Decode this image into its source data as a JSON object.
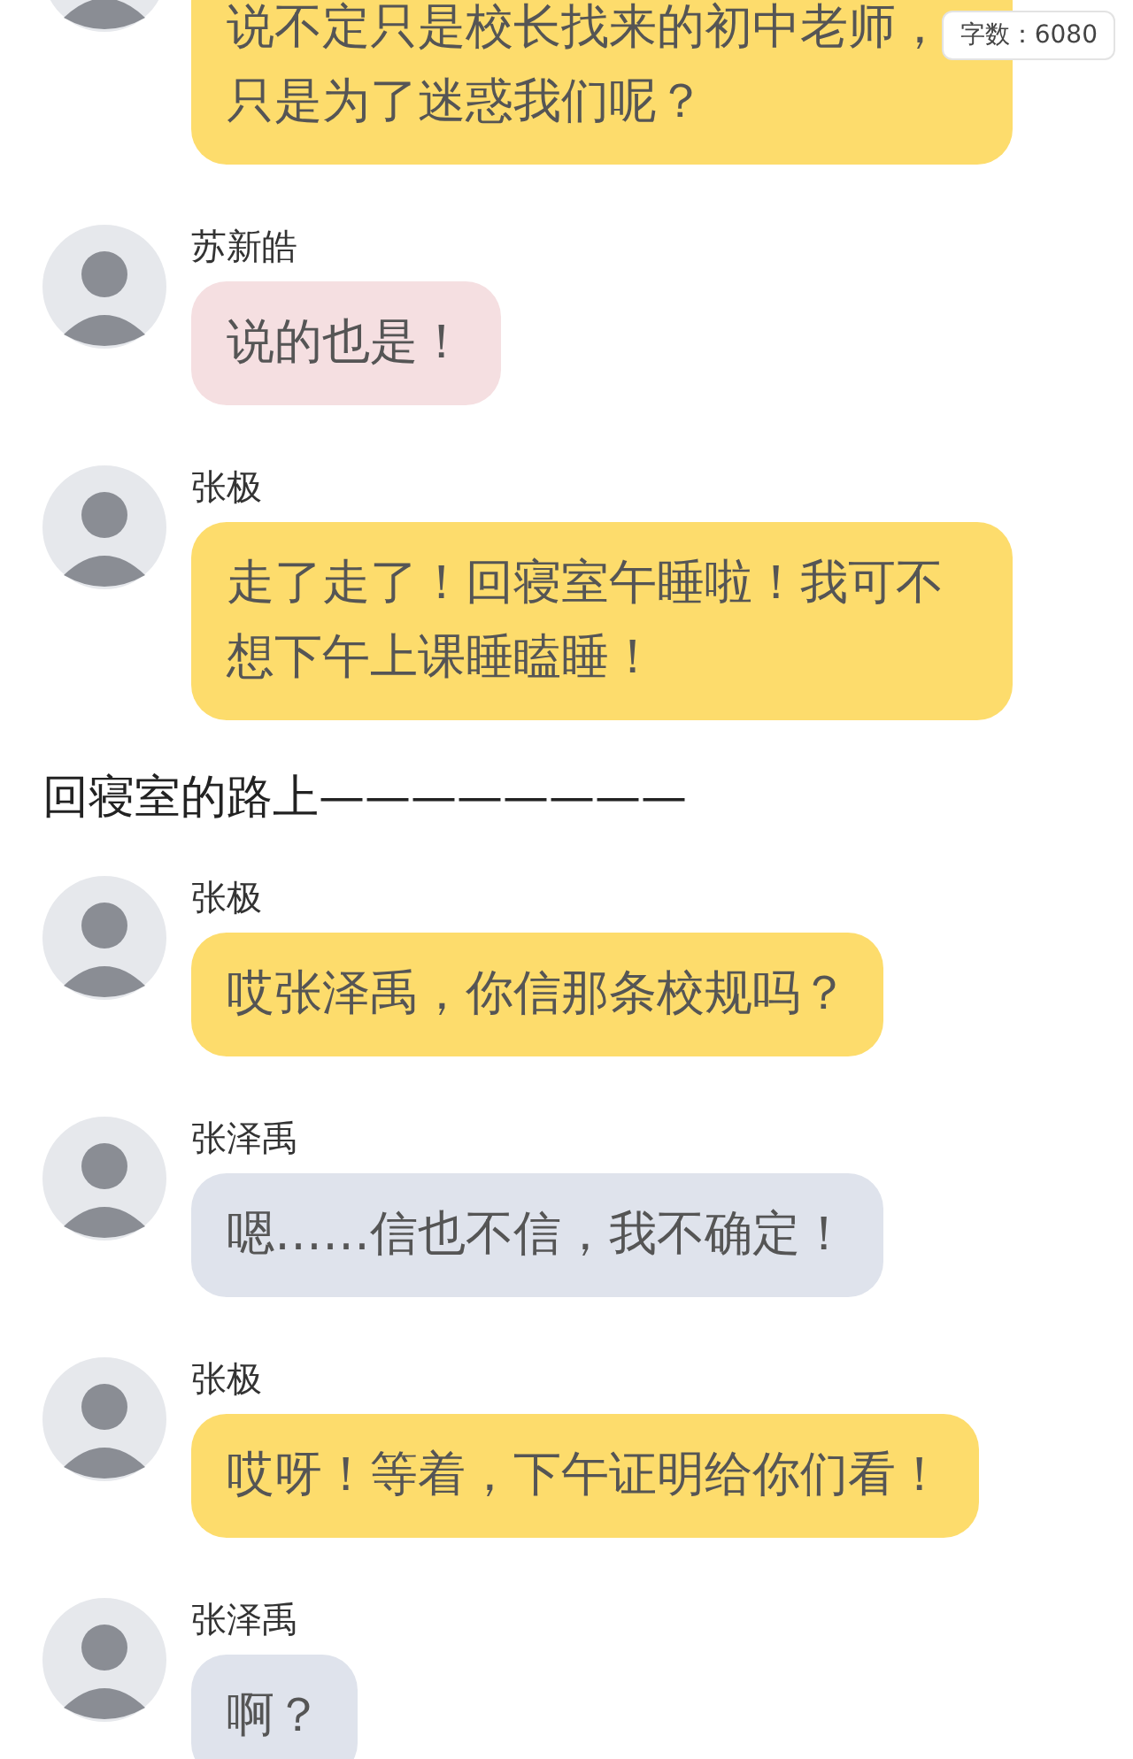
{
  "word_count": "字数：6080",
  "items": [
    {
      "kind": "message",
      "color": "#fddc6c",
      "text": "说不定只是校长找来的初中老师，只是为了迷惑我们呢？"
    },
    {
      "kind": "message",
      "sender": "苏新皓",
      "color": "#f5dfe1",
      "text": "说的也是！"
    },
    {
      "kind": "message",
      "sender": "张极",
      "color": "#fddc6c",
      "text": "走了走了！回寝室午睡啦！我可不想下午上课睡瞌睡！"
    },
    {
      "kind": "narration",
      "text": "回寝室的路上————————"
    },
    {
      "kind": "message",
      "sender": "张极",
      "color": "#fddc6c",
      "text": "哎张泽禹，你信那条校规吗？"
    },
    {
      "kind": "message",
      "sender": "张泽禹",
      "color": "#dfe3ec",
      "text": "嗯……信也不信，我不确定！"
    },
    {
      "kind": "message",
      "sender": "张极",
      "color": "#fddc6c",
      "text": "哎呀！等着，下午证明给你们看！"
    },
    {
      "kind": "message",
      "sender": "张泽禹",
      "color": "#dfe3ec",
      "text": "啊？"
    }
  ]
}
